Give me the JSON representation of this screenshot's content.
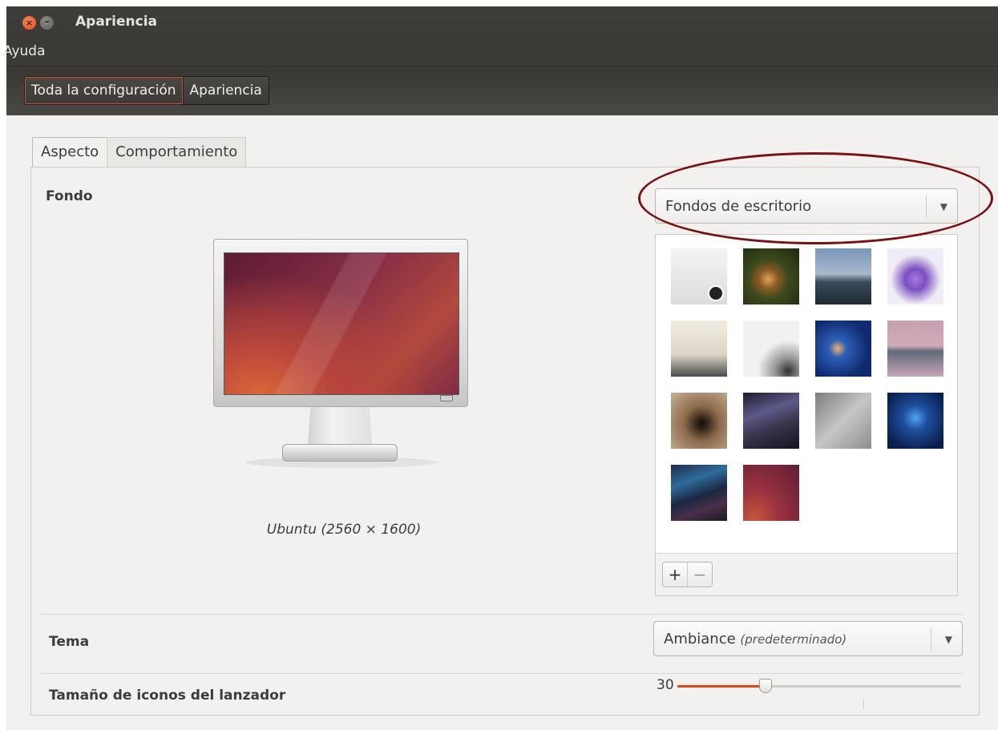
{
  "window": {
    "title": "Apariencia"
  },
  "menubar": {
    "items": [
      "Ayuda"
    ]
  },
  "breadcrumbs": [
    "Toda la configuración",
    "Apariencia"
  ],
  "tabs": [
    "Aspecto",
    "Comportamiento"
  ],
  "fondo": {
    "label": "Fondo",
    "source_select": "Fondos de escritorio",
    "preview_caption": "Ubuntu (2560 × 1600)",
    "add_label": "+",
    "remove_label": "−",
    "thumbnails": [
      "bg-1",
      "bg-2",
      "bg-3",
      "bg-4",
      "bg-5",
      "bg-6",
      "bg-7",
      "bg-8",
      "bg-9",
      "bg-10",
      "bg-11",
      "bg-12",
      "bg-13",
      "bg-14"
    ]
  },
  "tema": {
    "label": "Tema",
    "value": "Ambiance",
    "hint": "(predeterminado)"
  },
  "launcher": {
    "label": "Tamaño de iconos del lanzador",
    "value": "30",
    "value_fraction": 0.31
  },
  "colors": {
    "accent": "#dd4814",
    "titlebar": "#3c3b37",
    "highlight": "#7b1212"
  },
  "icons": {
    "close": "close-icon",
    "minimize": "minimize-icon",
    "dropdown": "triangle-down-icon"
  }
}
